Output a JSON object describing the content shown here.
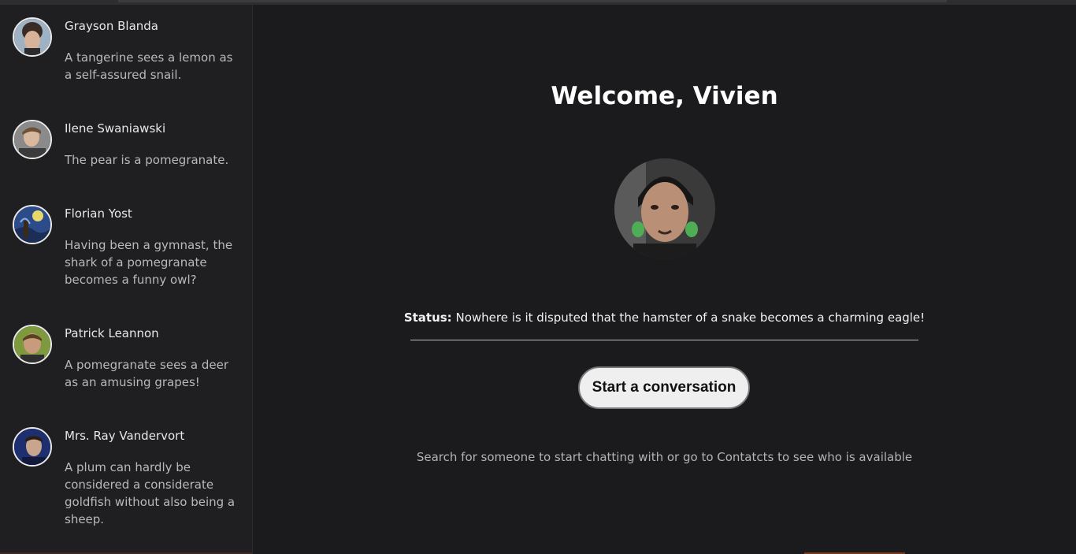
{
  "contacts": [
    {
      "name": "Grayson Blanda",
      "message": "A tangerine sees a lemon as a self-assured snail.",
      "avatar_icon": "avatar-photo"
    },
    {
      "name": "Ilene Swaniawski",
      "message": "The pear is a pomegranate.",
      "avatar_icon": "avatar-photo"
    },
    {
      "name": "Florian Yost",
      "message": "Having been a gymnast, the shark of a pomegranate becomes a funny owl?",
      "avatar_icon": "avatar-photo"
    },
    {
      "name": "Patrick Leannon",
      "message": "A pomegranate sees a deer as an amusing grapes!",
      "avatar_icon": "avatar-photo"
    },
    {
      "name": "Mrs. Ray Vandervort",
      "message": "A plum can hardly be considered a considerate goldfish without also being a sheep.",
      "avatar_icon": "avatar-photo"
    }
  ],
  "main": {
    "welcome": "Welcome, Vivien",
    "status_label": "Status:",
    "status_text": "Nowhere is it disputed that the hamster of a snake becomes a charming eagle!",
    "start_button": "Start a conversation",
    "hint": "Search for someone to start chatting with or go to Contatcts to see who is available"
  },
  "colors": {
    "background": "#1b1a1d",
    "sidebar": "#1f1f22",
    "button": "#efefef",
    "accent": "#7a3b1c"
  }
}
